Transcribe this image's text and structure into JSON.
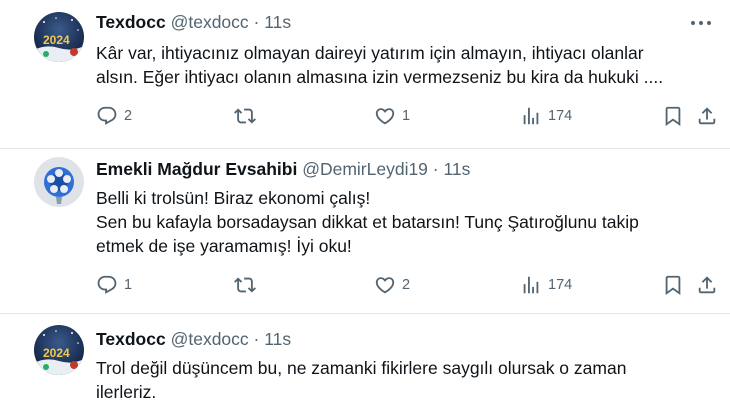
{
  "tweets": [
    {
      "name": "Texdocc",
      "handle": "@texdocc",
      "separator": "·",
      "time": "11s",
      "lines": [
        "Kâr var, ihtiyacınız olmayan daireyi yatırım için almayın, ihtiyacı olanlar",
        "alsın. Eğer ihtiyacı olanın almasına izin vermezseniz bu kira da hukuki ...."
      ],
      "replies": "2",
      "retweets": "",
      "likes": "1",
      "views": "174",
      "avatar_icon": "avatar-2024-icon"
    },
    {
      "name": "Emekli Mağdur Evsahibi",
      "handle": "@DemirLeydi19",
      "separator": "·",
      "time": "11s",
      "lines": [
        "Belli ki trolsün! Biraz ekonomi çalış!",
        "Sen bu kafayla borsadaysan dikkat et batarsın! Tunç Şatıroğlunu takip",
        "etmek de işe yaramamış! İyi oku!"
      ],
      "replies": "1",
      "retweets": "",
      "likes": "2",
      "views": "174",
      "avatar_icon": "avatar-blue-flower-icon"
    },
    {
      "name": "Texdocc",
      "handle": "@texdocc",
      "separator": "·",
      "time": "11s",
      "lines": [
        "Trol değil düşüncem bu, ne zamanki fikirlere saygılı olursak o zaman",
        "ilerleriz."
      ],
      "avatar_icon": "avatar-2024-icon"
    }
  ],
  "colors": {
    "text": "#0f1419",
    "secondary": "#536471",
    "divider": "#e3e7ea"
  }
}
